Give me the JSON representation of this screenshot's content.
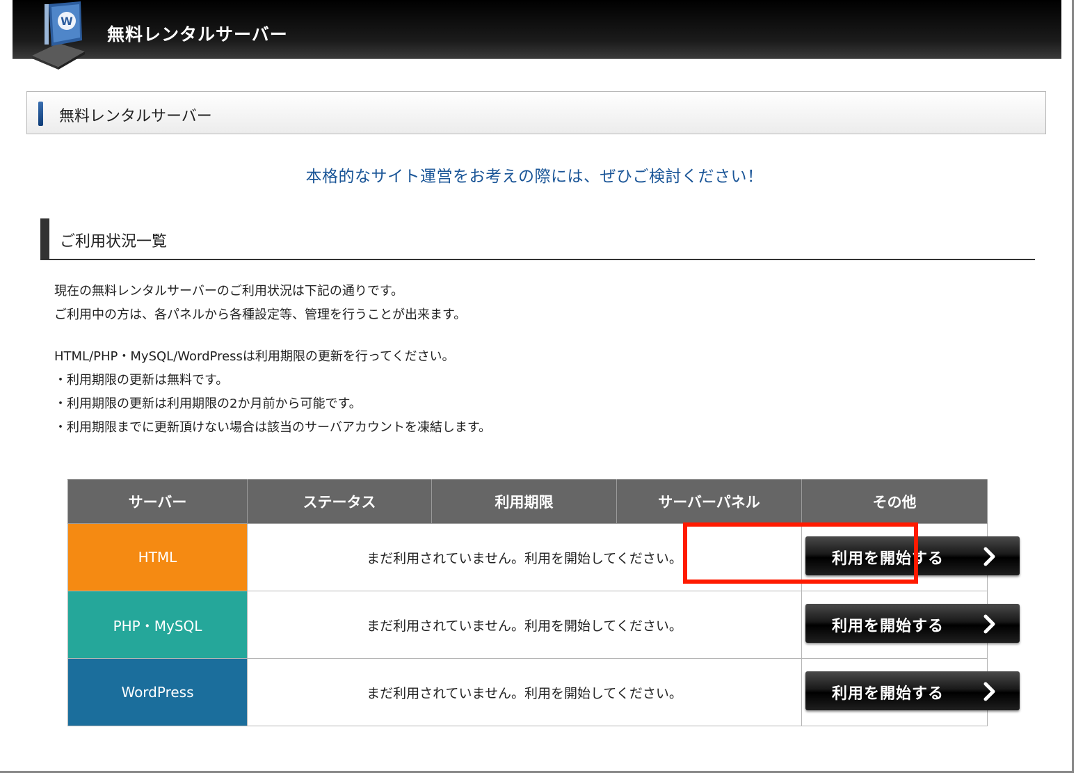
{
  "header": {
    "title": "無料レンタルサーバー",
    "logo_icon": "server-laptop-icon"
  },
  "section": {
    "title": "無料レンタルサーバー"
  },
  "lead": "本格的なサイト運営をお考えの際には、ぜひご検討ください！",
  "usage": {
    "title": "ご利用状況一覧",
    "intro": [
      "現在の無料レンタルサーバーのご利用状況は下記の通りです。",
      "ご利用中の方は、各パネルから各種設定等、管理を行うことが出来ます。"
    ],
    "notes": [
      "HTML/PHP・MySQL/WordPressは利用期限の更新を行ってください。",
      "・利用期限の更新は無料です。",
      "・利用期限の更新は利用期限の2か月前から可能です。",
      "・利用期限までに更新頂けない場合は該当のサーバアカウントを凍結します。"
    ]
  },
  "table": {
    "headers": [
      "サーバー",
      "ステータス",
      "利用期限",
      "サーバーパネル",
      "その他"
    ],
    "rows": [
      {
        "server": "HTML",
        "color": "#f58a12",
        "status": "まだ利用されていません。利用を開始してください。",
        "button": "利用を開始する",
        "highlighted": true
      },
      {
        "server": "PHP・MySQL",
        "color": "#25a79a",
        "status": "まだ利用されていません。利用を開始してください。",
        "button": "利用を開始する",
        "highlighted": false
      },
      {
        "server": "WordPress",
        "color": "#1b6e9c",
        "status": "まだ利用されていません。利用を開始してください。",
        "button": "利用を開始する",
        "highlighted": false
      }
    ]
  },
  "colors": {
    "accent_blue": "#1a5597",
    "highlight_red": "#ff1a00",
    "header_gray": "#666666"
  }
}
